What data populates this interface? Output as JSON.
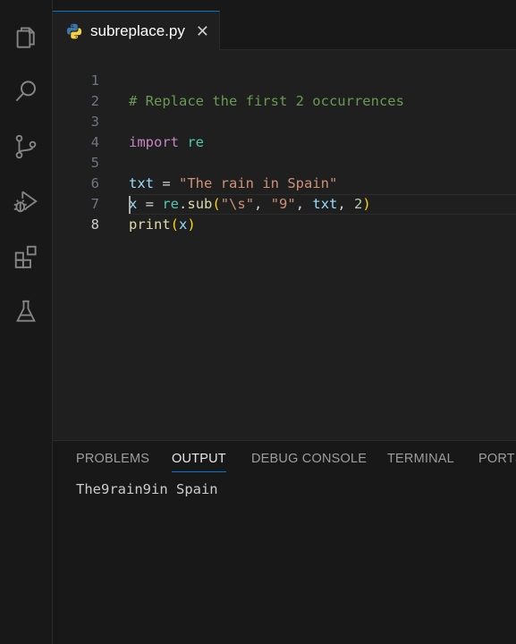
{
  "activity_bar": {
    "icons": [
      "explorer-icon",
      "search-icon",
      "source-control-icon",
      "run-debug-icon",
      "extensions-icon",
      "testing-icon"
    ]
  },
  "tab": {
    "filename": "subreplace.py",
    "close_glyph": "✕",
    "icon": "python-icon"
  },
  "editor": {
    "line_numbers": [
      "1",
      "2",
      "3",
      "4",
      "5",
      "6",
      "7",
      "8"
    ],
    "active_line": "8",
    "lines": {
      "l1": {
        "comment": "# Replace the first 2 occurrences"
      },
      "l3": {
        "keyword": "import",
        "module": "re"
      },
      "l5": {
        "var": "txt",
        "op": " = ",
        "str": "\"The rain in Spain\""
      },
      "l6": {
        "var": "x",
        "op": " = ",
        "mod": "re",
        "dot": ".",
        "func": "sub",
        "open": "(",
        "s1": "\"\\s\"",
        "c1": ", ",
        "s2": "\"9\"",
        "c2": ", ",
        "arg": "txt",
        "c3": ", ",
        "num": "2",
        "close": ")"
      },
      "l7": {
        "func": "print",
        "open": "(",
        "arg": "x",
        "close": ")"
      }
    }
  },
  "panel": {
    "tabs": [
      "PROBLEMS",
      "OUTPUT",
      "DEBUG CONSOLE",
      "TERMINAL",
      "PORTS"
    ],
    "active_tab": "OUTPUT",
    "output": "The9rain9in Spain"
  },
  "colors": {
    "accent": "#0078d4",
    "background": "#1f1f1f",
    "sidebar": "#181818"
  }
}
